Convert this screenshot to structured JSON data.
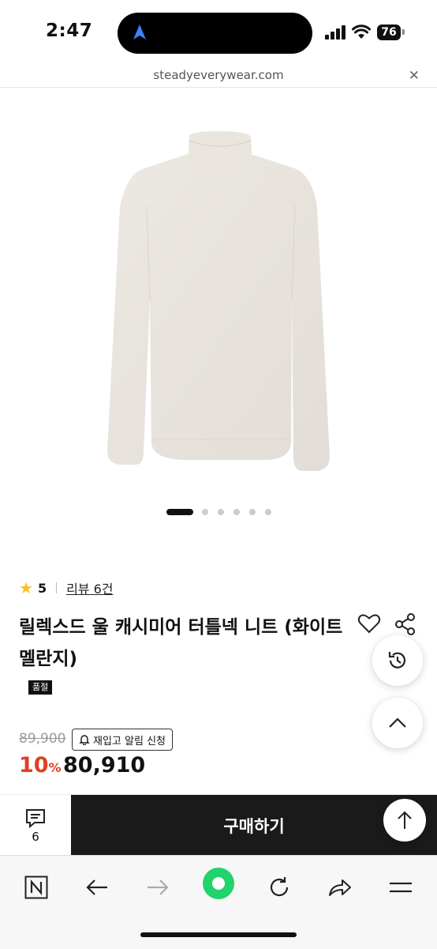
{
  "status_bar": {
    "time": "2:47",
    "battery": "76"
  },
  "browser": {
    "url": "steadyeverywear.com"
  },
  "carousel": {
    "count": 6,
    "active_index": 0
  },
  "product": {
    "rating": "5",
    "review_link": "리뷰 6건",
    "title": "릴렉스드 울 캐시미어 터틀넥 니트 (화이트 멜란지)",
    "soldout_badge": "품절",
    "original_price": "89,900",
    "restock_button": "재입고 알림 신청",
    "discount_value": "10",
    "discount_unit": "%",
    "sale_price": "80,910"
  },
  "bottom_bar": {
    "comment_count": "6",
    "buy_label": "구매하기"
  },
  "colors": {
    "accent_discount": "#e0401f",
    "star": "#f6c41b",
    "buy_button": "#1a1a1a",
    "active_nav": "#22d36b"
  },
  "icons": [
    "location-arrow-icon",
    "signal-icon",
    "wifi-icon",
    "battery-icon",
    "close-icon",
    "star-icon",
    "heart-icon",
    "share-icon",
    "history-icon",
    "chevron-up-icon",
    "bell-icon",
    "comment-icon",
    "arrow-up-icon",
    "naver-n-icon",
    "back-arrow-icon",
    "forward-arrow-icon",
    "green-dot-icon",
    "refresh-icon",
    "share-arrow-icon",
    "menu-icon"
  ]
}
